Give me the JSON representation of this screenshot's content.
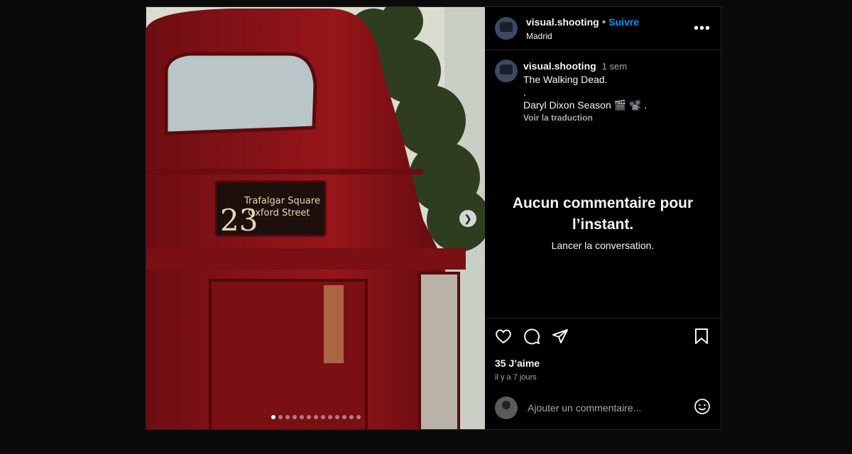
{
  "post": {
    "username": "visual.shooting",
    "separator": "•",
    "follow_label": "Suivre",
    "location": "Madrid",
    "more_label": "•••"
  },
  "media": {
    "bus_route_number": "23",
    "bus_destination_line1": "Trafalgar Square",
    "bus_destination_line2": "Oxford Street",
    "slide_count": 13,
    "active_slide": 1
  },
  "caption": {
    "username": "visual.shooting",
    "time": "1 sem",
    "line1": "The Walking Dead.",
    "line2": ".",
    "line3": "Daryl Dixon Season 🎬 📽️ .",
    "translate_label": "Voir la traduction"
  },
  "comments_empty": {
    "title": "Aucun commentaire pour l’instant.",
    "subtitle": "Lancer la conversation."
  },
  "actions": {
    "likes": "35 J’aime",
    "posted_ago": "il y a 7 jours"
  },
  "comment_box": {
    "placeholder": "Ajouter un commentaire..."
  },
  "icons": [
    "chevron-right-icon",
    "more-icon",
    "heart-icon",
    "comment-icon",
    "share-icon",
    "bookmark-icon",
    "emoji-icon"
  ],
  "colors": {
    "accent": "#0095f6",
    "bus_red": "#8b1418"
  }
}
